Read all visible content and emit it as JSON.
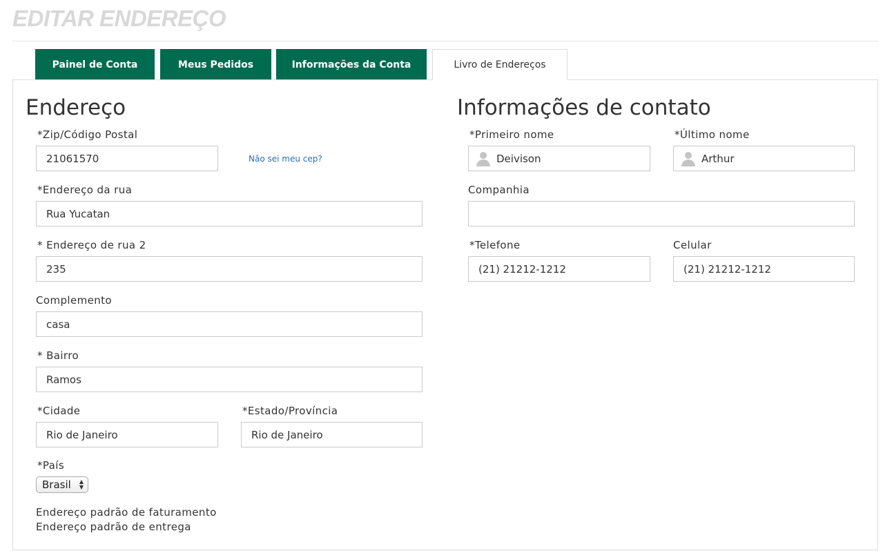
{
  "page": {
    "title": "EDITAR ENDEREÇO"
  },
  "tabs": [
    {
      "label": "Painel de Conta",
      "active": false
    },
    {
      "label": "Meus Pedidos",
      "active": false
    },
    {
      "label": "Informações da Conta",
      "active": false
    },
    {
      "label": "Livro de Endereços",
      "active": true
    }
  ],
  "address": {
    "heading": "Endereço",
    "zip": {
      "label": "*Zip/Código Postal",
      "value": "21061570"
    },
    "zip_help_link": "Não sei meu cep?",
    "street": {
      "label": "*Endereço da rua",
      "value": "Rua Yucatan"
    },
    "street2": {
      "label": "* Endereço de rua 2",
      "value": "235"
    },
    "complement": {
      "label": "Complemento",
      "value": "casa"
    },
    "neighborhood": {
      "label": "* Bairro",
      "value": "Ramos"
    },
    "city": {
      "label": "*Cidade",
      "value": "Rio de Janeiro"
    },
    "state": {
      "label": "*Estado/Província",
      "value": "Rio de Janeiro"
    },
    "country": {
      "label": "*País",
      "selected": "Brasil"
    },
    "default_billing": "Endereço padrão de faturamento",
    "default_shipping": "Endereço padrão de entrega"
  },
  "contact": {
    "heading": "Informações de contato",
    "first_name": {
      "label": "*Primeiro nome",
      "value": "Deivison",
      "icon": "person-icon"
    },
    "last_name": {
      "label": "*Último nome",
      "value": "Arthur",
      "icon": "person-icon"
    },
    "company": {
      "label": "Companhia",
      "value": ""
    },
    "phone": {
      "label": "*Telefone",
      "value": "(21) 21212-1212"
    },
    "mobile": {
      "label": "Celular",
      "value": "(21) 21212-1212"
    }
  },
  "colors": {
    "tab_background": "#006b4f",
    "title_color": "#d8d8d8",
    "link_color": "#2a6fb3"
  }
}
